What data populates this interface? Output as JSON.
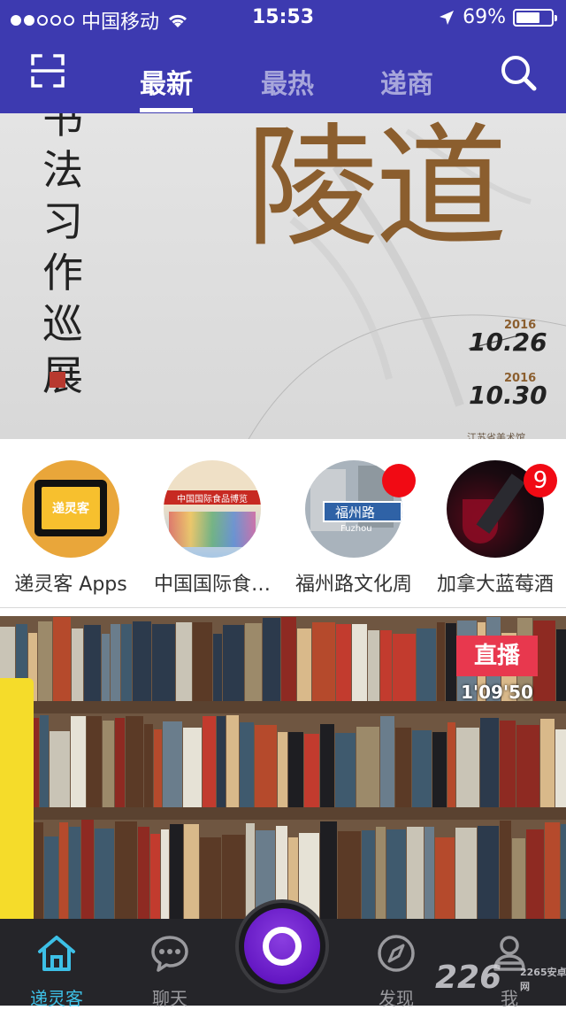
{
  "status_bar": {
    "carrier": "中国移动",
    "time": "15:53",
    "battery": "69%",
    "battery_level": 0.69
  },
  "header": {
    "tabs": [
      {
        "label": "最新",
        "active": true
      },
      {
        "label": "最热",
        "active": false
      },
      {
        "label": "递商",
        "active": false
      }
    ],
    "scan_icon": "scan-icon",
    "search_icon": "search-icon"
  },
  "banner": {
    "headline": "陵道",
    "calligraphy": [
      "书",
      "法",
      "习",
      "作",
      "巡",
      "展",
      "展"
    ],
    "date_start": {
      "year": "2016",
      "day": "10.26"
    },
    "date_end": {
      "year": "2016",
      "day": "10.30"
    },
    "venue": "江苏省美术馆"
  },
  "stories": [
    {
      "label": "递灵客 Apps",
      "badge": "",
      "thumb_text": "递灵客",
      "colors": [
        "#e8a33a",
        "#f6bf2f"
      ]
    },
    {
      "label": "中国国际食…",
      "badge": "",
      "thumb_text": "中国国际食品博览",
      "colors": [
        "#efe0c6",
        "#a8c7e5"
      ]
    },
    {
      "label": "福州路文化周",
      "badge": "dot",
      "thumb_text": "福州路",
      "thumb_sub": "Fuzhou",
      "colors": [
        "#a9b3bc",
        "#2f62a6"
      ]
    },
    {
      "label": "加拿大蓝莓酒",
      "badge": "9",
      "thumb_text": "",
      "colors": [
        "#0a0a12",
        "#7a0a20"
      ]
    }
  ],
  "live": {
    "tag": "直播",
    "duration": "1'09'50"
  },
  "nav": {
    "items": [
      {
        "label": "递灵客",
        "icon": "home-icon",
        "active": true
      },
      {
        "label": "聊天",
        "icon": "chat-icon",
        "active": false
      },
      {
        "label": "发现",
        "icon": "compass-icon",
        "active": false
      },
      {
        "label": "我",
        "icon": "profile-icon",
        "active": false
      }
    ],
    "center_icon": "record-icon"
  },
  "watermark": {
    "main": "226",
    "sub": "2265安卓网"
  },
  "colors": {
    "header_bg": "#3d3ab0",
    "nav_bg": "#252529",
    "nav_active": "#3dc0e6",
    "live_tag": "#e8384e",
    "badge": "#f10a14"
  }
}
